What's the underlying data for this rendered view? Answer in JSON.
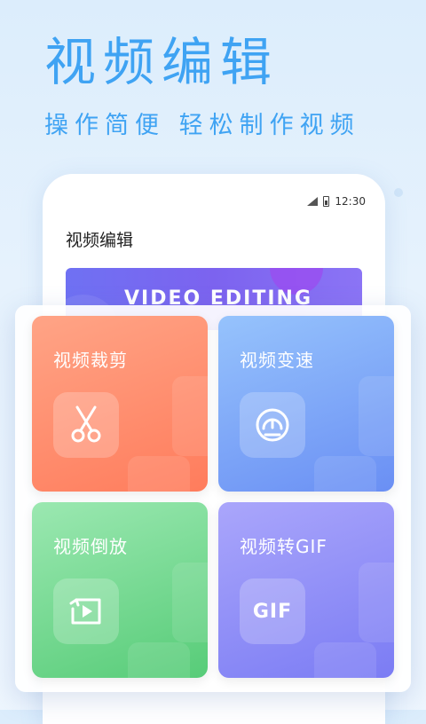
{
  "hero": {
    "title": "视频编辑",
    "subtitle": "操作简便 轻松制作视频"
  },
  "phone": {
    "status_time": "12:30",
    "title": "视频编辑",
    "banner_text": "VIDEO EDITING"
  },
  "features": [
    {
      "label": "视频裁剪",
      "icon": "scissors-icon",
      "colors": [
        "#ff9a7b",
        "#ff7e5e"
      ]
    },
    {
      "label": "视频变速",
      "icon": "speedometer-icon",
      "colors": [
        "#8ab8fb",
        "#6a93f5"
      ]
    },
    {
      "label": "视频倒放",
      "icon": "reverse-play-icon",
      "colors": [
        "#8fe2a8",
        "#5ccf7c"
      ]
    },
    {
      "label": "视频转GIF",
      "icon": "gif-icon",
      "icon_text": "GIF",
      "colors": [
        "#a9a3fb",
        "#7b7bf5"
      ]
    }
  ],
  "colors": {
    "accent": "#3fa3f3",
    "banner": "#7c63ef"
  }
}
